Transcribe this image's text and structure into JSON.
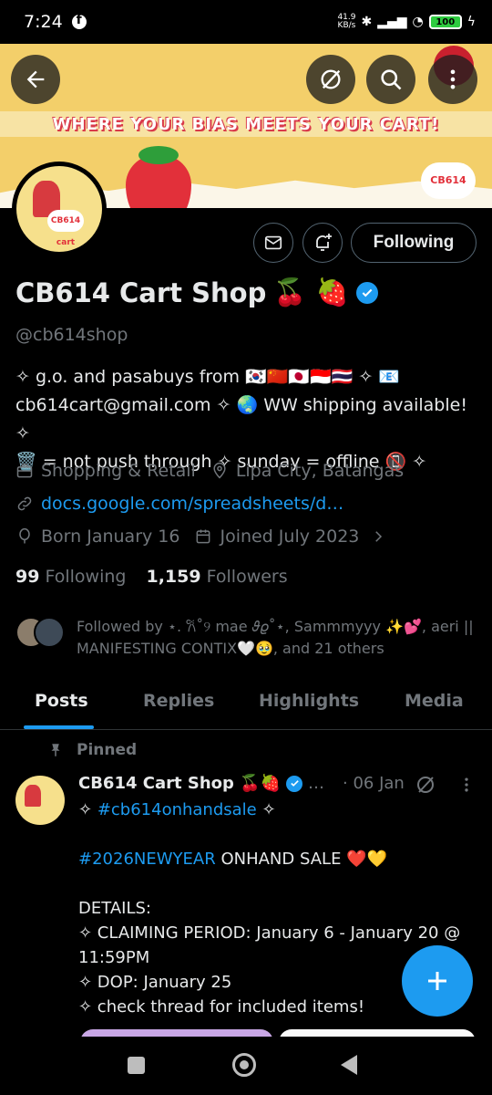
{
  "status_bar": {
    "time": "7:24",
    "speed_value": "41.9",
    "speed_unit": "KB/s",
    "battery": "100"
  },
  "banner": {
    "tagline": "WHERE YOUR BIAS MEETS YOUR CART!",
    "logo_text": "CB614 cart",
    "accent_color": "#f3cf6a"
  },
  "actions": {
    "follow_label": "Following"
  },
  "profile": {
    "name": "CB614 Cart Shop",
    "name_emoji": "🍒 🍓",
    "handle": "@cb614shop",
    "bio_lines": [
      "✧ g.o. and pasabuys from 🇰🇷🇨🇳🇯🇵🇮🇩🇹🇭 ✧ 📧",
      "cb614cart@gmail.com ✧ 🌏 WW shipping available! ✧",
      "🗑️ = not push through ✧ sunday = offline 📵 ✧"
    ],
    "category": "Shopping & Retail",
    "location": "Lipa City, Batangas",
    "link": "docs.google.com/spreadsheets/d…",
    "born": "Born January 16",
    "joined": "Joined July 2023",
    "following_count": "99",
    "following_label": "Following",
    "followers_count": "1,159",
    "followers_label": "Followers",
    "followed_by": "Followed by ⋆. 𐙚˚୨ mae 𝜗𝜚˚⋆, Sammmyyy ✨💕, aeri || MANIFESTING CONTIX🤍🥹, and 21 others"
  },
  "tabs": [
    "Posts",
    "Replies",
    "Highlights",
    "Media"
  ],
  "post": {
    "pinned_label": "Pinned",
    "author": "CB614 Cart Shop 🍒🍓",
    "more": "…",
    "date": "· 06 Jan",
    "line1_prefix": "✧ ",
    "line1_tag": "#cb614onhandsale",
    "line1_suffix": " ✧",
    "line2_tag": "#2026NEWYEAR",
    "line2_rest": " ONHAND SALE ❤️💛",
    "details": "DETAILS:\n✧ CLAIMING PERIOD: January 6 - January 20 @ 11:59PM\n✧ DOP: January 25\n✧ check thread for included items!"
  },
  "colors": {
    "accent": "#1d9bf0",
    "muted": "#71767b",
    "text": "#e7e9ea",
    "background": "#000000"
  }
}
